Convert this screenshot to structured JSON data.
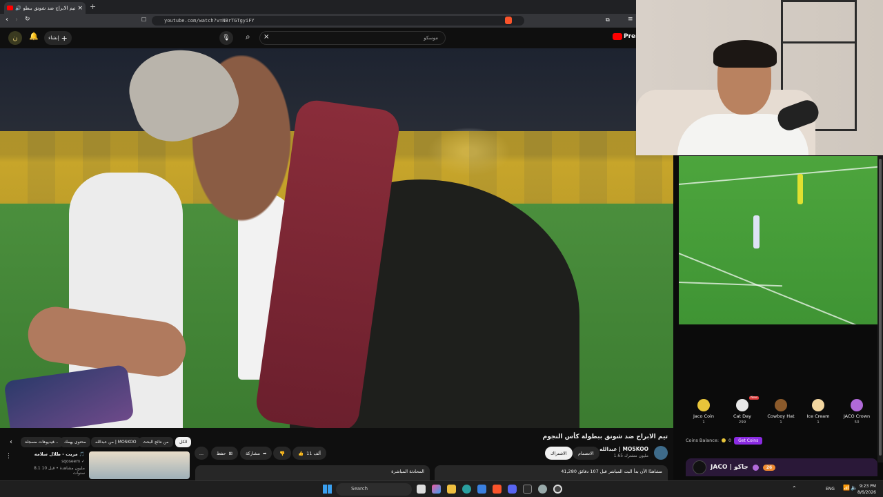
{
  "browser": {
    "tab_title": "تيم الابراج ضد شونق ببطولة كأ...",
    "new_tab": "+",
    "close_tab": "×",
    "url": "youtube.com/watch?v=NBrTGTgyiFY"
  },
  "youtube": {
    "search_value": "موسكو",
    "search_clear": "×",
    "create_label": "إنشاء",
    "premium_label": "Prem"
  },
  "video": {
    "title": "تيم الابراج ضد شونق ببطولة كأس النجوم",
    "channel": "عبدالله | MOSKOO",
    "subscribers": "1.65 مليون مشترك",
    "subscribe_label": "الاشتراك",
    "join_label": "الانضمام",
    "likes": "11 ألف",
    "share_label": "مشاركة",
    "save_label": "حفظ",
    "more_label": "...",
    "description_text": "41,280 مشاهدًا الآن  بدأ البث المباشر قبل 107 دقائق",
    "description_more": "ا لبط الابدي",
    "live_chat_label": "المحادثة المباشرة"
  },
  "chips": [
    "الكل",
    "من نتائج البحث",
    "من عبدالله | MOSKOO",
    "محتوى يهمك",
    "فيديوهات مسجلة..."
  ],
  "recommendation": {
    "title": "مريت - طلال سلامه 🎵",
    "channel": "sqoseem ✓",
    "meta": "8.1 مليون مشاهدة • قبل 10 سنوات"
  },
  "stream_panel": {
    "gifts": [
      {
        "name": "Jaco Coin",
        "price": "1",
        "color": "#e8c53a"
      },
      {
        "name": "Cat Day",
        "price": "299",
        "color": "#e8e8e8",
        "badge": "New"
      },
      {
        "name": "Cowboy Hat",
        "price": "1",
        "color": "#8b5a2b"
      },
      {
        "name": "Ice Cream",
        "price": "1",
        "color": "#f3d6a0"
      },
      {
        "name": "JACO Crown",
        "price": "50",
        "color": "#b06ad8"
      }
    ],
    "coins_balance_label": "Coins Balance:",
    "coins_balance": "0",
    "get_coins": "Get Coins",
    "streamer_name": "JACO | جاكو",
    "streamer_level": "26"
  },
  "taskbar": {
    "search_label": "Search",
    "lang": "ENG",
    "time": "9:23 PM",
    "date": "8/6/2026"
  },
  "colors": {
    "yt_red": "#ff0000",
    "accent_purple": "#8a2be2",
    "bg_dark": "#0f0f0f"
  }
}
